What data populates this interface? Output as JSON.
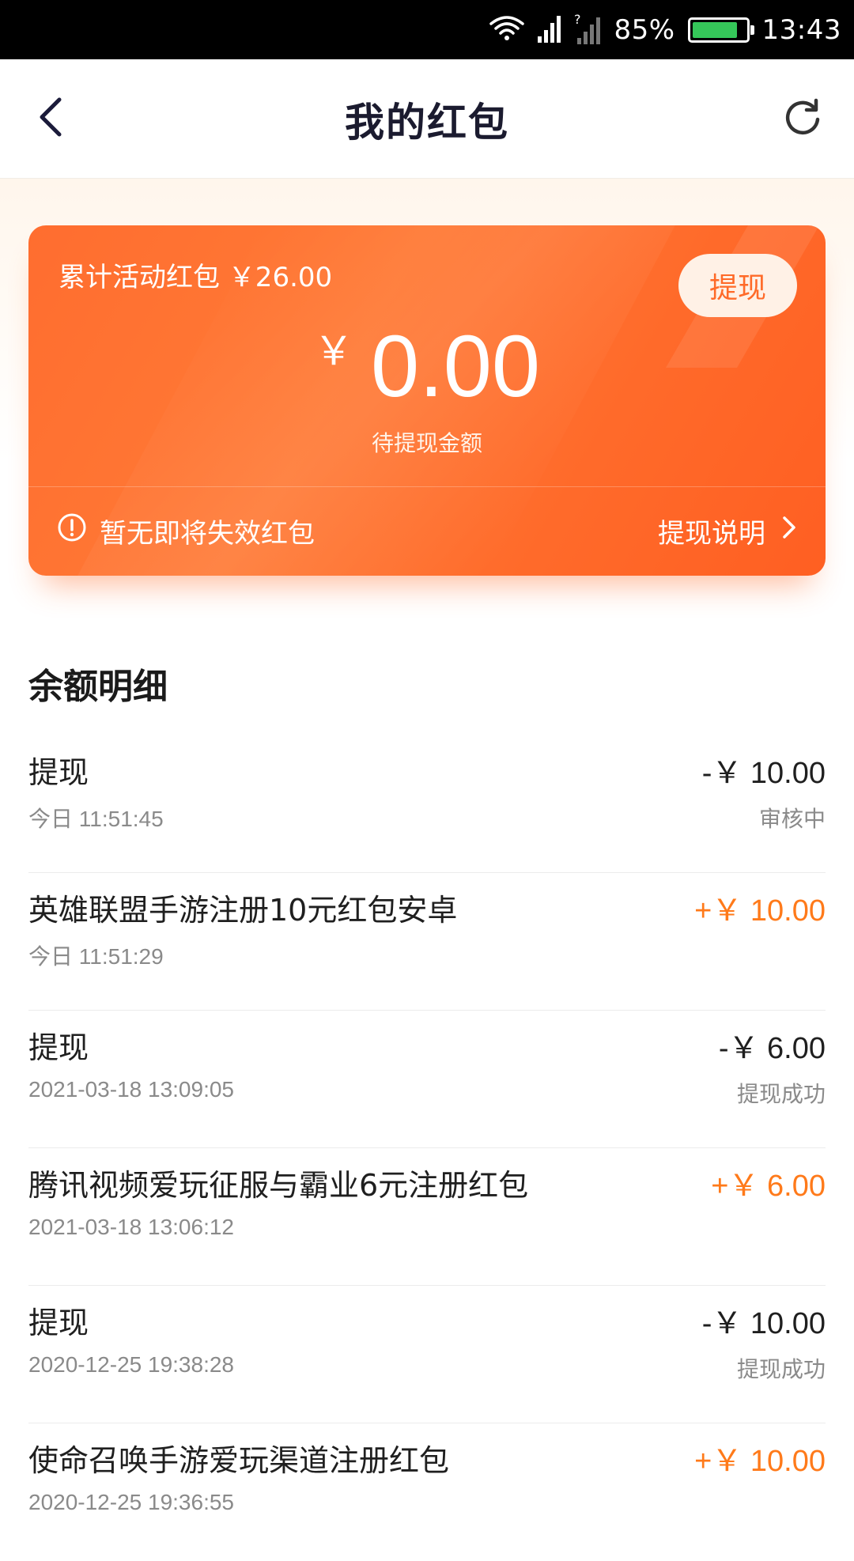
{
  "status_bar": {
    "battery": "85%",
    "battery_level": 0.85,
    "time": "13:43"
  },
  "header": {
    "title": "我的红包"
  },
  "card": {
    "total_label": "累计活动红包 ￥26.00",
    "withdraw_label": "提现",
    "currency": "￥",
    "balance": "0.00",
    "balance_caption": "待提现金额",
    "notice": "暂无即将失效红包",
    "withdraw_info_label": "提现说明"
  },
  "colors": {
    "accent": "#ff6a28",
    "positive": "#ff7a1a",
    "card_start": "#ff6d2f",
    "card_end": "#ff5f22"
  },
  "details": {
    "title": "余额明细",
    "items": [
      {
        "title": "提现",
        "time": "今日 11:51:45",
        "amount": "-￥ 10.00",
        "status": "审核中",
        "type": "neg"
      },
      {
        "title": "英雄联盟手游注册10元红包安卓",
        "time": "今日 11:51:29",
        "amount": "+￥ 10.00",
        "status": "",
        "type": "pos"
      },
      {
        "title": "提现",
        "time": "2021-03-18 13:09:05",
        "amount": "-￥ 6.00",
        "status": "提现成功",
        "type": "neg"
      },
      {
        "title": "腾讯视频爱玩征服与霸业6元注册红包",
        "time": "2021-03-18 13:06:12",
        "amount": "+￥ 6.00",
        "status": "",
        "type": "pos"
      },
      {
        "title": "提现",
        "time": "2020-12-25 19:38:28",
        "amount": "-￥ 10.00",
        "status": "提现成功",
        "type": "neg"
      },
      {
        "title": "使命召唤手游爱玩渠道注册红包",
        "time": "2020-12-25 19:36:55",
        "amount": "+￥ 10.00",
        "status": "",
        "type": "pos"
      }
    ]
  },
  "icons": {
    "back": "chevron-left-icon",
    "refresh": "refresh-icon",
    "notice": "exclamation-circle-icon",
    "more": "chevron-right-icon",
    "wifi": "wifi-icon",
    "signal": "signal-icon"
  }
}
